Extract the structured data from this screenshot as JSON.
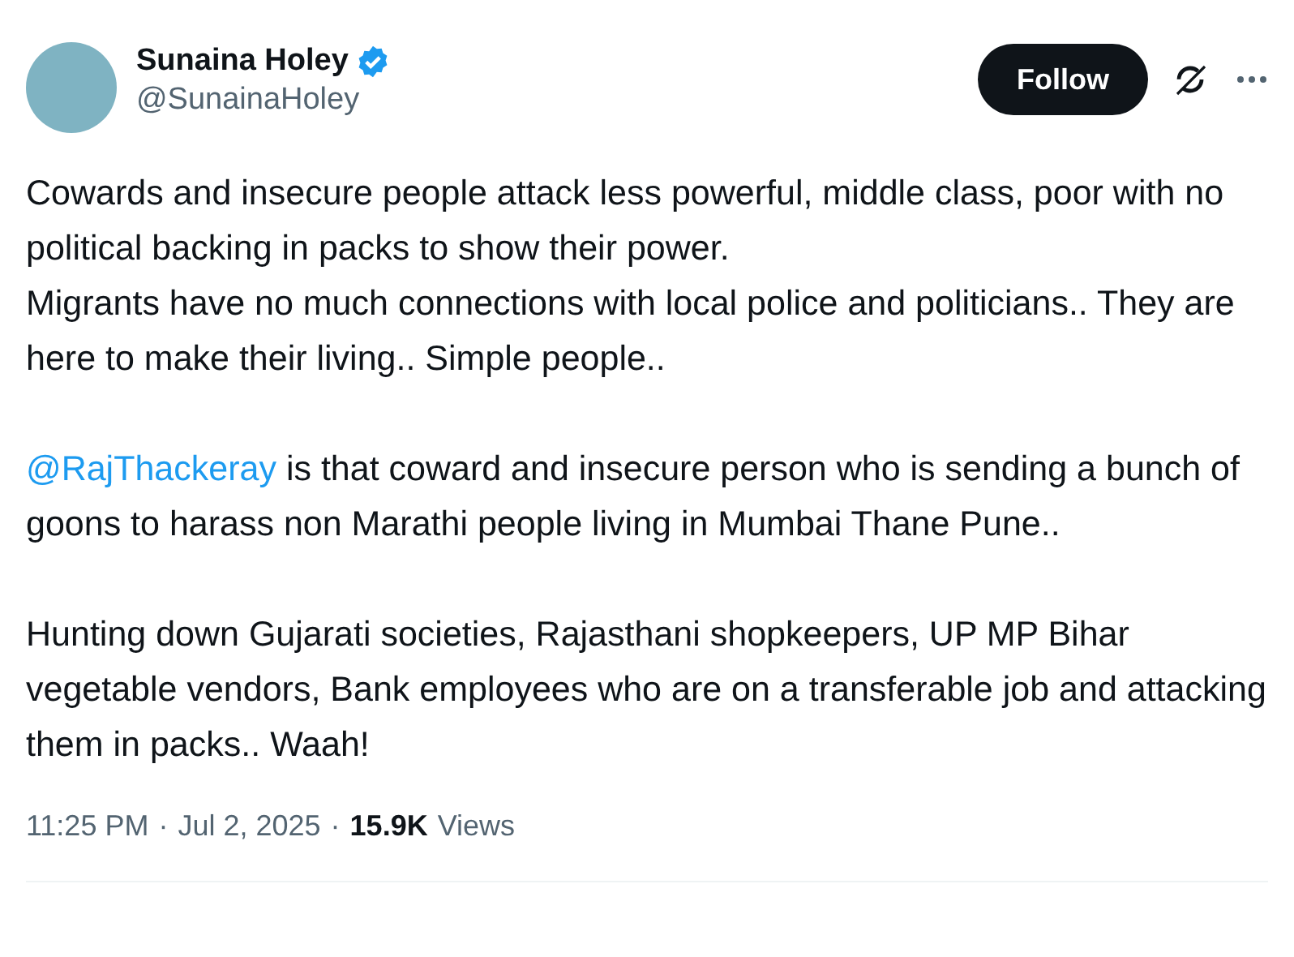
{
  "author": {
    "name": "Sunaina Holey",
    "handle": "@SunainaHoley",
    "verified": true
  },
  "follow_button": "Follow",
  "paragraphs": [
    {
      "lines": [
        "Cowards and insecure people attack less powerful, middle class, poor with no political backing in packs to show their power.",
        "Migrants have no much connections with local police and politicians.. They are here to make their living.. Simple people.."
      ]
    },
    {
      "mention": "@RajThackeray",
      "lines": [
        " is that coward and insecure person who is sending a bunch of goons to harass non Marathi people living in Mumbai Thane Pune.."
      ]
    },
    {
      "lines": [
        "Hunting down Gujarati societies, Rajasthani shopkeepers, UP MP Bihar vegetable vendors, Bank employees who are on a transferable job and attacking them in packs.. Waah!"
      ]
    }
  ],
  "footer": {
    "separator": "·",
    "time": "11:25 PM",
    "date": "Jul 2, 2025",
    "views_count": "15.9K",
    "views_label": "Views"
  }
}
